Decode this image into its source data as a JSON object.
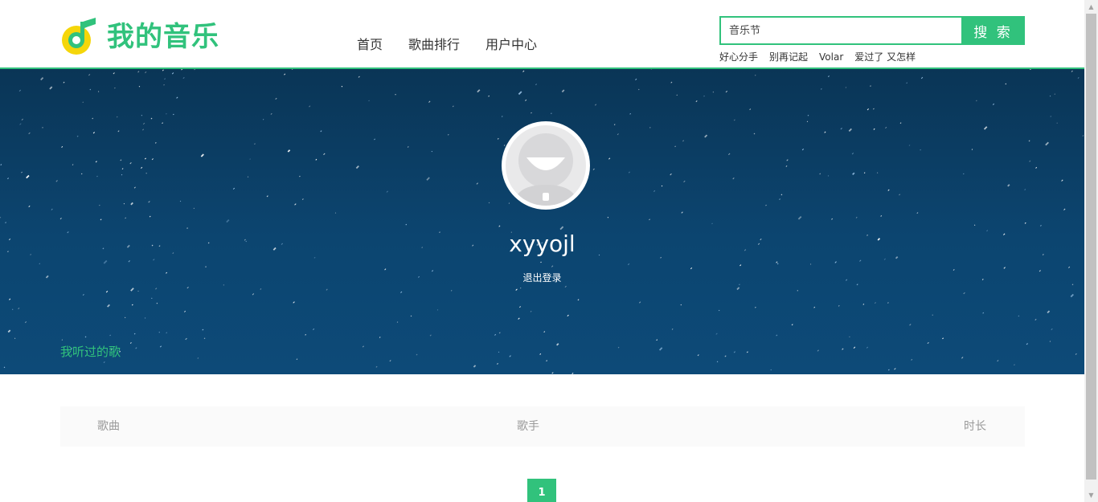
{
  "header": {
    "logo_text": "我的音乐",
    "nav": [
      "首页",
      "歌曲排行",
      "用户中心"
    ],
    "search": {
      "placeholder": "音乐节",
      "button_label": "搜 索"
    },
    "hot_words": [
      "好心分手",
      "别再记起",
      "Volar",
      "爱过了 又怎样"
    ]
  },
  "profile": {
    "username": "xyyojl",
    "logout_label": "退出登录",
    "section_title": "我听过的歌"
  },
  "table": {
    "columns": [
      "歌曲",
      "歌手",
      "时长"
    ],
    "rows": []
  },
  "pagination": {
    "current_page": "1"
  },
  "colors": {
    "accent": "#31c27c",
    "banner": "#0c4570"
  },
  "icons": {
    "logo": "music-note-icon",
    "avatar": "default-avatar-icon"
  }
}
